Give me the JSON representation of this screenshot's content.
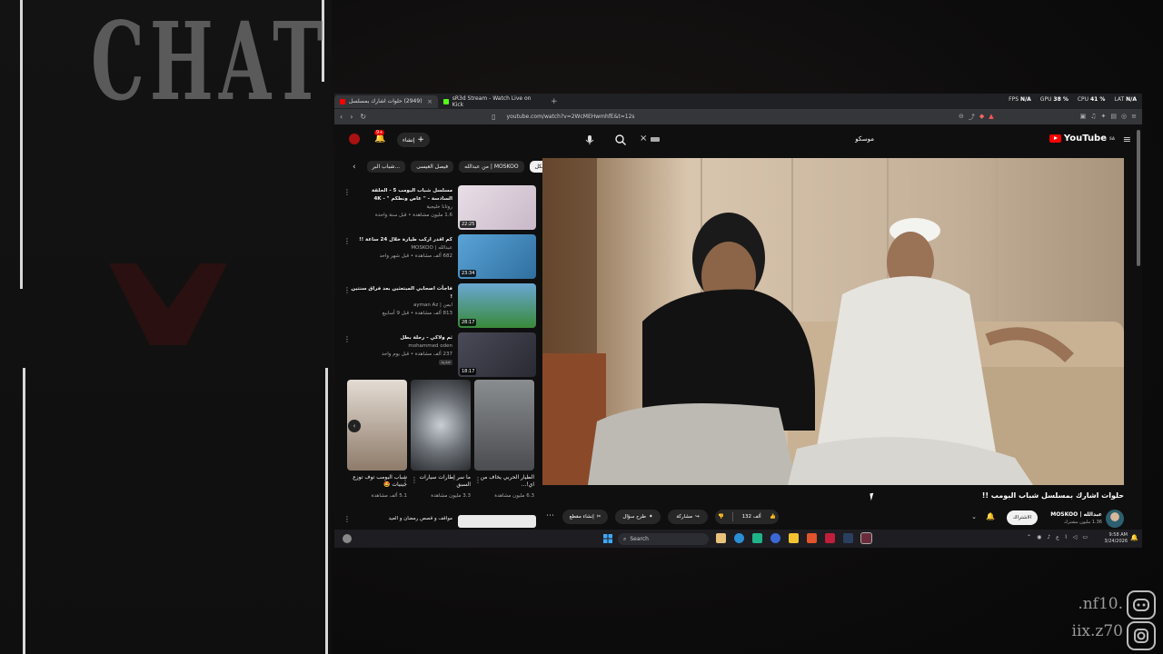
{
  "overlay": {
    "chat_title": "CHAT",
    "brand_tags": [
      ".nf10.",
      "iix.z70"
    ],
    "social_icons": [
      "discord-icon",
      "instagram-icon"
    ]
  },
  "browser": {
    "tabs": [
      {
        "label": "(2949) حلوات اشارك بمسلسل",
        "active": true,
        "favicon_color": "#ff0000"
      },
      {
        "label": "sR3d Stream - Watch Live on Kick",
        "active": false,
        "favicon_color": "#53fc18"
      }
    ],
    "new_tab": "+",
    "url": "youtube.com/watch?v=2WcMEHwmhfE&t=12s",
    "perf": {
      "fps_label": "FPS",
      "fps": "N/A",
      "gpu_label": "GPU",
      "gpu": "38 %",
      "cpu_label": "CPU",
      "cpu": "41 %",
      "lat_label": "LAT",
      "lat": "N/A"
    }
  },
  "youtube": {
    "logo_text": "YouTube",
    "logo_region": "SA",
    "search_query": "موسكو",
    "create_label": "إنشاء",
    "notification_count": "9+",
    "chips": [
      "الكل",
      "من عبدالله | MOSKOO",
      "فيصل العيسى",
      "شباب البر..."
    ],
    "side_videos": [
      {
        "title": "مسلسل شباب البومب 5 - الحلقة السادسة - \" عاص ونطكم \" - 4K",
        "channel": "روتانا خليجية",
        "views": "1.6 مليون مشاهدة • قبل سنة واحدة",
        "duration": "22:25",
        "thumb": "#d8d0d8"
      },
      {
        "title": "كم اقدر اركب طيارة خلال 24 ساعة !!",
        "channel": "عبدالله | MOSKOO",
        "views": "682 ألف مشاهدة • قبل شهر واحد",
        "duration": "23:34",
        "thumb": "#4a8ec4"
      },
      {
        "title": "فاجأت اصحابي المبتعثين بعد فراق سنتين !",
        "channel": "ايمن | ayman Az",
        "views": "813 ألف مشاهدة • قبل 9 أسابيع",
        "duration": "28:17",
        "thumb": "#3f7ea8"
      },
      {
        "title": "ثم ولاكي - رحلة بطل",
        "channel": "mohammed oden",
        "views": "237 ألف مشاهدة • قبل يوم واحد",
        "duration": "18:17",
        "badge": "جديد",
        "thumb": "#3b3b48"
      }
    ],
    "shorts": [
      {
        "title": "الطيار الحربي يخاف من اي!...",
        "views": "6.3 مليون مشاهدة",
        "thumb": "#6b6e72"
      },
      {
        "title": "ما سر إطارات سيارات السبق",
        "views": "3.3 مليون مشاهدة",
        "thumb": "#9aa0a6"
      },
      {
        "title": "شباب البومب توف توزع جينيات 🤩",
        "views": "5.1 ألف مشاهدة",
        "thumb": "#c7b7a4"
      }
    ],
    "last_item_title": "مواقف و قصص رمضان و العيد",
    "video_title": "حلوات اشارك بمسلسل شباب البومب !!",
    "channel_name": "عبدالله | MOSKOO",
    "subscribers": "1.36 مليون مشترك",
    "subscribe_label": "الاشتراك",
    "likes": "132 ألف",
    "share_label": "مشاركة",
    "ask_label": "طرح سؤال",
    "clip_label": "إنشاء مقطع"
  },
  "taskbar": {
    "search_label": "Search",
    "time": "9:58 AM",
    "date": "3/24/2026",
    "lang": "ع"
  },
  "colors": {
    "yt_red": "#ff0000",
    "accent_white": "#f1f1f1",
    "bg": "#0f0f0f"
  }
}
